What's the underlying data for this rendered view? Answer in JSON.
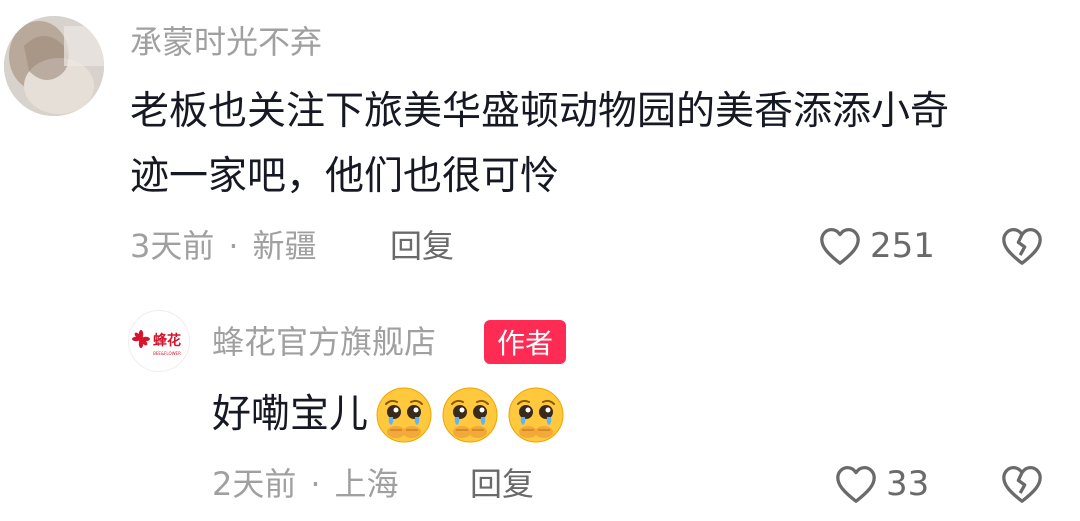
{
  "comments": [
    {
      "username": "承蒙时光不弃",
      "text_line1": "老板也关注下旅美华盛顿动物园的美香添添小奇",
      "text_line2": "迹一家吧，他们也很可怜",
      "time": "3天前",
      "location": "新疆",
      "reply_label": "回复",
      "likes": "251",
      "dot": "·"
    },
    {
      "username": "蜂花官方旗舰店",
      "author_badge": "作者",
      "avatar_text": "蜂花",
      "avatar_subtext": "BEE&FLOWER",
      "text": "好嘞宝儿",
      "emojis": [
        "pleading-crying-face",
        "pleading-crying-face",
        "pleading-crying-face"
      ],
      "time": "2天前",
      "location": "上海",
      "reply_label": "回复",
      "likes": "33",
      "dot": "·"
    }
  ],
  "colors": {
    "primary_text": "#161823",
    "secondary_text": "#a0a0a0",
    "badge_bg": "#fe2c55",
    "brand_red": "#d6142c"
  }
}
